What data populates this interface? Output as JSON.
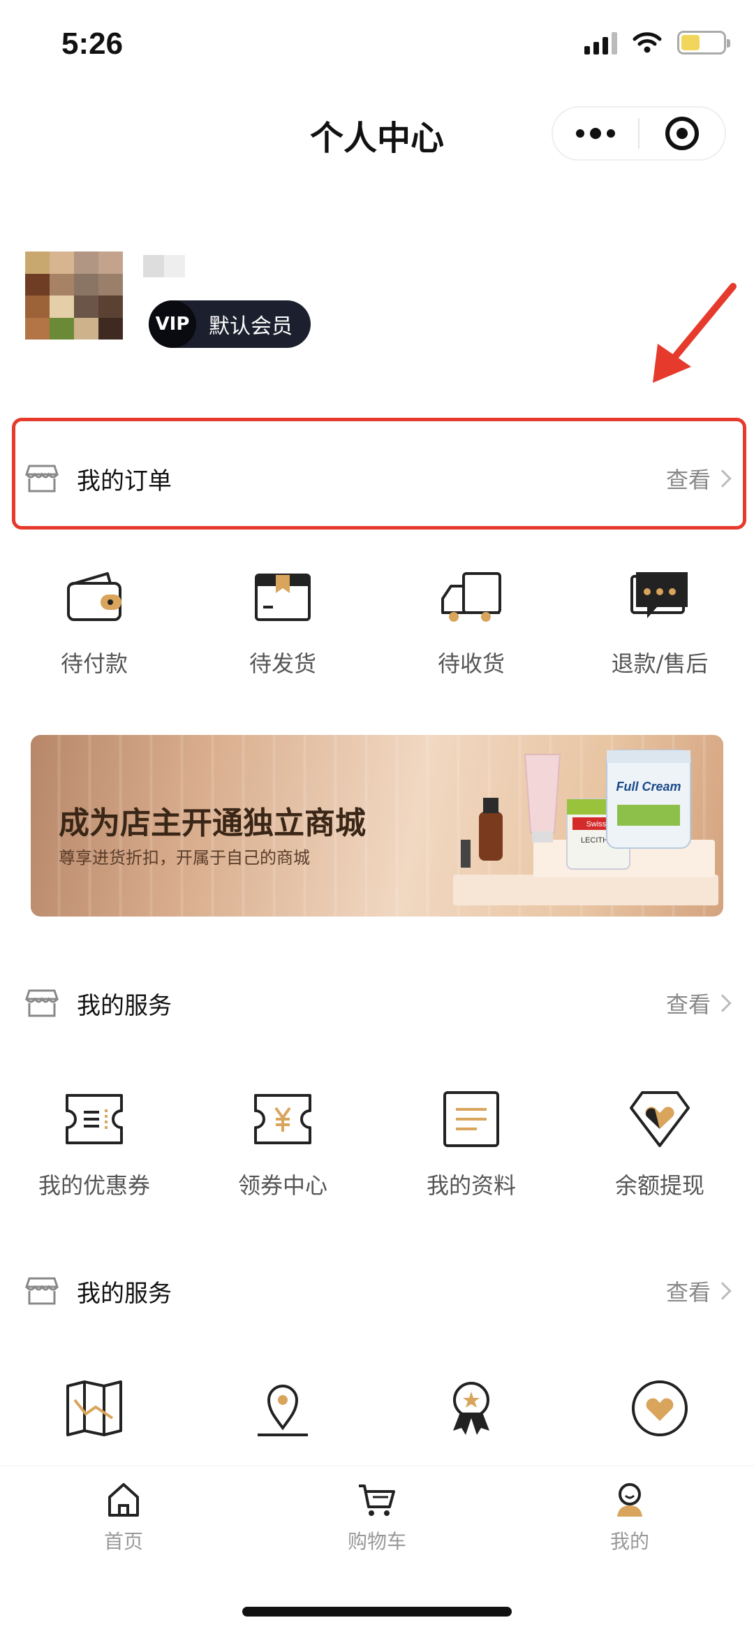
{
  "status_bar": {
    "time": "5:26"
  },
  "nav": {
    "title": "个人中心"
  },
  "profile": {
    "vip_badge": "VIP",
    "member_level": "默认会员"
  },
  "orders": {
    "title": "我的订单",
    "view": "查看",
    "items": [
      {
        "label": "待付款",
        "icon": "wallet-icon"
      },
      {
        "label": "待发货",
        "icon": "package-icon"
      },
      {
        "label": "待收货",
        "icon": "truck-icon"
      },
      {
        "label": "退款/售后",
        "icon": "chat-bubble-icon"
      }
    ]
  },
  "banner": {
    "title": "成为店主开通独立商城",
    "subtitle": "尊享进货折扣，开属于自己的商城",
    "product_labels": [
      "Full Cream",
      "LECITHIN",
      "Swisse"
    ]
  },
  "services1": {
    "title": "我的服务",
    "view": "查看",
    "items": [
      {
        "label": "我的优惠券",
        "icon": "ticket-icon"
      },
      {
        "label": "领券中心",
        "icon": "yen-ticket-icon"
      },
      {
        "label": "我的资料",
        "icon": "document-icon"
      },
      {
        "label": "余额提现",
        "icon": "diamond-heart-icon"
      }
    ]
  },
  "services2": {
    "title": "我的服务",
    "view": "查看",
    "items": [
      {
        "label": "",
        "icon": "map-icon"
      },
      {
        "label": "",
        "icon": "location-pin-icon"
      },
      {
        "label": "",
        "icon": "award-icon"
      },
      {
        "label": "",
        "icon": "heart-circle-icon"
      }
    ]
  },
  "tabbar": {
    "items": [
      {
        "label": "首页",
        "icon": "home-icon"
      },
      {
        "label": "购物车",
        "icon": "cart-icon"
      },
      {
        "label": "我的",
        "icon": "profile-icon"
      }
    ]
  },
  "colors": {
    "accent": "#D9A45B",
    "highlight": "#E53A2C",
    "dark": "#1C1F2E"
  }
}
